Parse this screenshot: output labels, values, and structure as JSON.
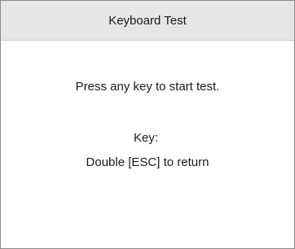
{
  "window": {
    "title": "Keyboard Test"
  },
  "main": {
    "prompt": "Press any key to start test.",
    "key_label": "Key:",
    "key_value": "",
    "return_hint": "Double [ESC] to return"
  }
}
